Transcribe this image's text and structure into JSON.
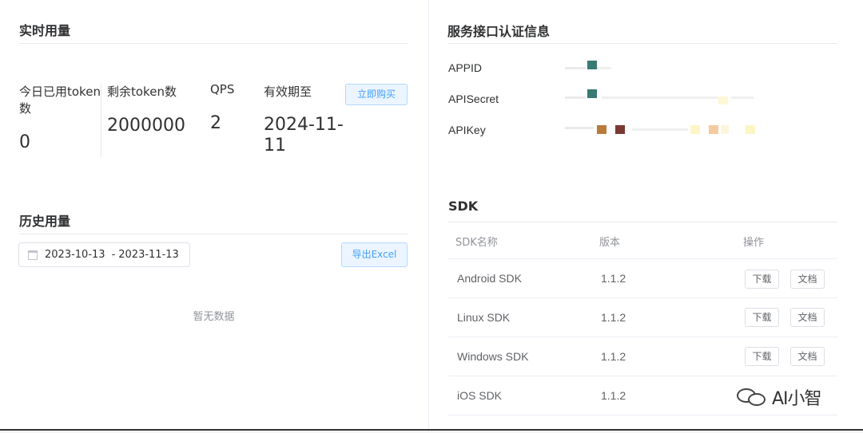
{
  "realtime": {
    "title": "实时用量",
    "stats": [
      {
        "label": "今日已用token数",
        "value": "0"
      },
      {
        "label": "剩余token数",
        "value": "2000000"
      },
      {
        "label": "QPS",
        "value": "2"
      },
      {
        "label": "有效期至",
        "value": "2024-11-11"
      }
    ],
    "buy_label": "立即购买"
  },
  "history": {
    "title": "历史用量",
    "date_start": "2023-10-13",
    "date_sep": "-",
    "date_end": "2023-11-13",
    "export_label": "导出Excel",
    "empty_text": "暂无数据"
  },
  "auth": {
    "title": "服务接口认证信息",
    "fields": [
      {
        "label": "APPID"
      },
      {
        "label": "APISecret"
      },
      {
        "label": "APIKey"
      }
    ]
  },
  "sdk": {
    "title": "SDK",
    "columns": [
      "SDK名称",
      "版本",
      "操作"
    ],
    "download_label": "下载",
    "doc_label": "文档",
    "rows": [
      {
        "name": "Android SDK",
        "version": "1.1.2"
      },
      {
        "name": "Linux SDK",
        "version": "1.1.2"
      },
      {
        "name": "Windows SDK",
        "version": "1.1.2"
      },
      {
        "name": "iOS SDK",
        "version": "1.1.2"
      }
    ]
  },
  "watermark": {
    "text": "AI小智",
    "icon": "wechat-icon"
  }
}
